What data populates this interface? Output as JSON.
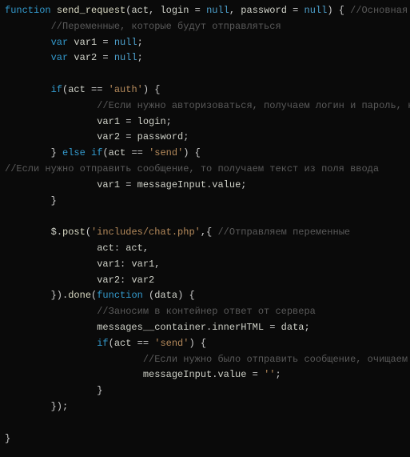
{
  "code": {
    "tokens": [
      [
        [
          "kw",
          "function "
        ],
        [
          "fn",
          "send_request"
        ],
        [
          "pn",
          "("
        ],
        [
          "id",
          "act"
        ],
        [
          "pn",
          ", "
        ],
        [
          "id",
          "login"
        ],
        [
          "pn",
          " = "
        ],
        [
          "null",
          "null"
        ],
        [
          "pn",
          ", "
        ],
        [
          "id",
          "password"
        ],
        [
          "pn",
          " = "
        ],
        [
          "null",
          "null"
        ],
        [
          "pn",
          ") { "
        ],
        [
          "cm",
          "//Основная функция"
        ]
      ],
      [
        [
          "pn",
          "        "
        ],
        [
          "cm",
          "//Переменные, которые будут отправляться"
        ]
      ],
      [
        [
          "pn",
          "        "
        ],
        [
          "kw",
          "var "
        ],
        [
          "id",
          "var1"
        ],
        [
          "pn",
          " = "
        ],
        [
          "null",
          "null"
        ],
        [
          "pn",
          ";"
        ]
      ],
      [
        [
          "pn",
          "        "
        ],
        [
          "kw",
          "var "
        ],
        [
          "id",
          "var2"
        ],
        [
          "pn",
          " = "
        ],
        [
          "null",
          "null"
        ],
        [
          "pn",
          ";"
        ]
      ],
      [
        [
          "pn",
          " "
        ]
      ],
      [
        [
          "pn",
          "        "
        ],
        [
          "kw",
          "if"
        ],
        [
          "pn",
          "("
        ],
        [
          "id",
          "act"
        ],
        [
          "pn",
          " == "
        ],
        [
          "str",
          "'auth'"
        ],
        [
          "pn",
          ") {"
        ]
      ],
      [
        [
          "pn",
          "                "
        ],
        [
          "cm",
          "//Если нужно авторизоваться, получаем логин и пароль, которые бы"
        ]
      ],
      [
        [
          "pn",
          "                "
        ],
        [
          "id",
          "var1"
        ],
        [
          "pn",
          " = "
        ],
        [
          "id",
          "login"
        ],
        [
          "pn",
          ";"
        ]
      ],
      [
        [
          "pn",
          "                "
        ],
        [
          "id",
          "var2"
        ],
        [
          "pn",
          " = "
        ],
        [
          "id",
          "password"
        ],
        [
          "pn",
          ";"
        ]
      ],
      [
        [
          "pn",
          "        } "
        ],
        [
          "kw",
          "else if"
        ],
        [
          "pn",
          "("
        ],
        [
          "id",
          "act"
        ],
        [
          "pn",
          " == "
        ],
        [
          "str",
          "'send'"
        ],
        [
          "pn",
          ") {"
        ]
      ],
      [
        [
          "cm",
          "//Если нужно отправить сообщение, то получаем текст из поля ввода"
        ]
      ],
      [
        [
          "pn",
          "                "
        ],
        [
          "id",
          "var1"
        ],
        [
          "pn",
          " = "
        ],
        [
          "id",
          "messageInput"
        ],
        [
          "pn",
          "."
        ],
        [
          "id",
          "value"
        ],
        [
          "pn",
          ";"
        ]
      ],
      [
        [
          "pn",
          "        }"
        ]
      ],
      [
        [
          "pn",
          " "
        ]
      ],
      [
        [
          "pn",
          "        "
        ],
        [
          "id",
          "$"
        ],
        [
          "pn",
          "."
        ],
        [
          "fn",
          "post"
        ],
        [
          "pn",
          "("
        ],
        [
          "str",
          "'includes/chat.php'"
        ],
        [
          "pn",
          ",{ "
        ],
        [
          "cm",
          "//Отправляем переменные"
        ]
      ],
      [
        [
          "pn",
          "                "
        ],
        [
          "id",
          "act"
        ],
        [
          "pn",
          ": "
        ],
        [
          "id",
          "act"
        ],
        [
          "pn",
          ","
        ]
      ],
      [
        [
          "pn",
          "                "
        ],
        [
          "id",
          "var1"
        ],
        [
          "pn",
          ": "
        ],
        [
          "id",
          "var1"
        ],
        [
          "pn",
          ","
        ]
      ],
      [
        [
          "pn",
          "                "
        ],
        [
          "id",
          "var2"
        ],
        [
          "pn",
          ": "
        ],
        [
          "id",
          "var2"
        ]
      ],
      [
        [
          "pn",
          "        })."
        ],
        [
          "fn",
          "done"
        ],
        [
          "pn",
          "("
        ],
        [
          "kw",
          "function "
        ],
        [
          "pn",
          "("
        ],
        [
          "id",
          "data"
        ],
        [
          "pn",
          ") {"
        ]
      ],
      [
        [
          "pn",
          "                "
        ],
        [
          "cm",
          "//Заносим в контейнер ответ от сервера"
        ]
      ],
      [
        [
          "pn",
          "                "
        ],
        [
          "id",
          "messages__container"
        ],
        [
          "pn",
          "."
        ],
        [
          "id",
          "innerHTML"
        ],
        [
          "pn",
          " = "
        ],
        [
          "id",
          "data"
        ],
        [
          "pn",
          ";"
        ]
      ],
      [
        [
          "pn",
          "                "
        ],
        [
          "kw",
          "if"
        ],
        [
          "pn",
          "("
        ],
        [
          "id",
          "act"
        ],
        [
          "pn",
          " == "
        ],
        [
          "str",
          "'send'"
        ],
        [
          "pn",
          ") {"
        ]
      ],
      [
        [
          "pn",
          "                        "
        ],
        [
          "cm",
          "//Если нужно было отправить сообщение, очищаем поле ввод"
        ]
      ],
      [
        [
          "pn",
          "                        "
        ],
        [
          "id",
          "messageInput"
        ],
        [
          "pn",
          "."
        ],
        [
          "id",
          "value"
        ],
        [
          "pn",
          " = "
        ],
        [
          "str",
          "''"
        ],
        [
          "pn",
          ";"
        ]
      ],
      [
        [
          "pn",
          "                }"
        ]
      ],
      [
        [
          "pn",
          "        });"
        ]
      ],
      [
        [
          "pn",
          " "
        ]
      ],
      [
        [
          "pn",
          "}"
        ]
      ]
    ]
  }
}
